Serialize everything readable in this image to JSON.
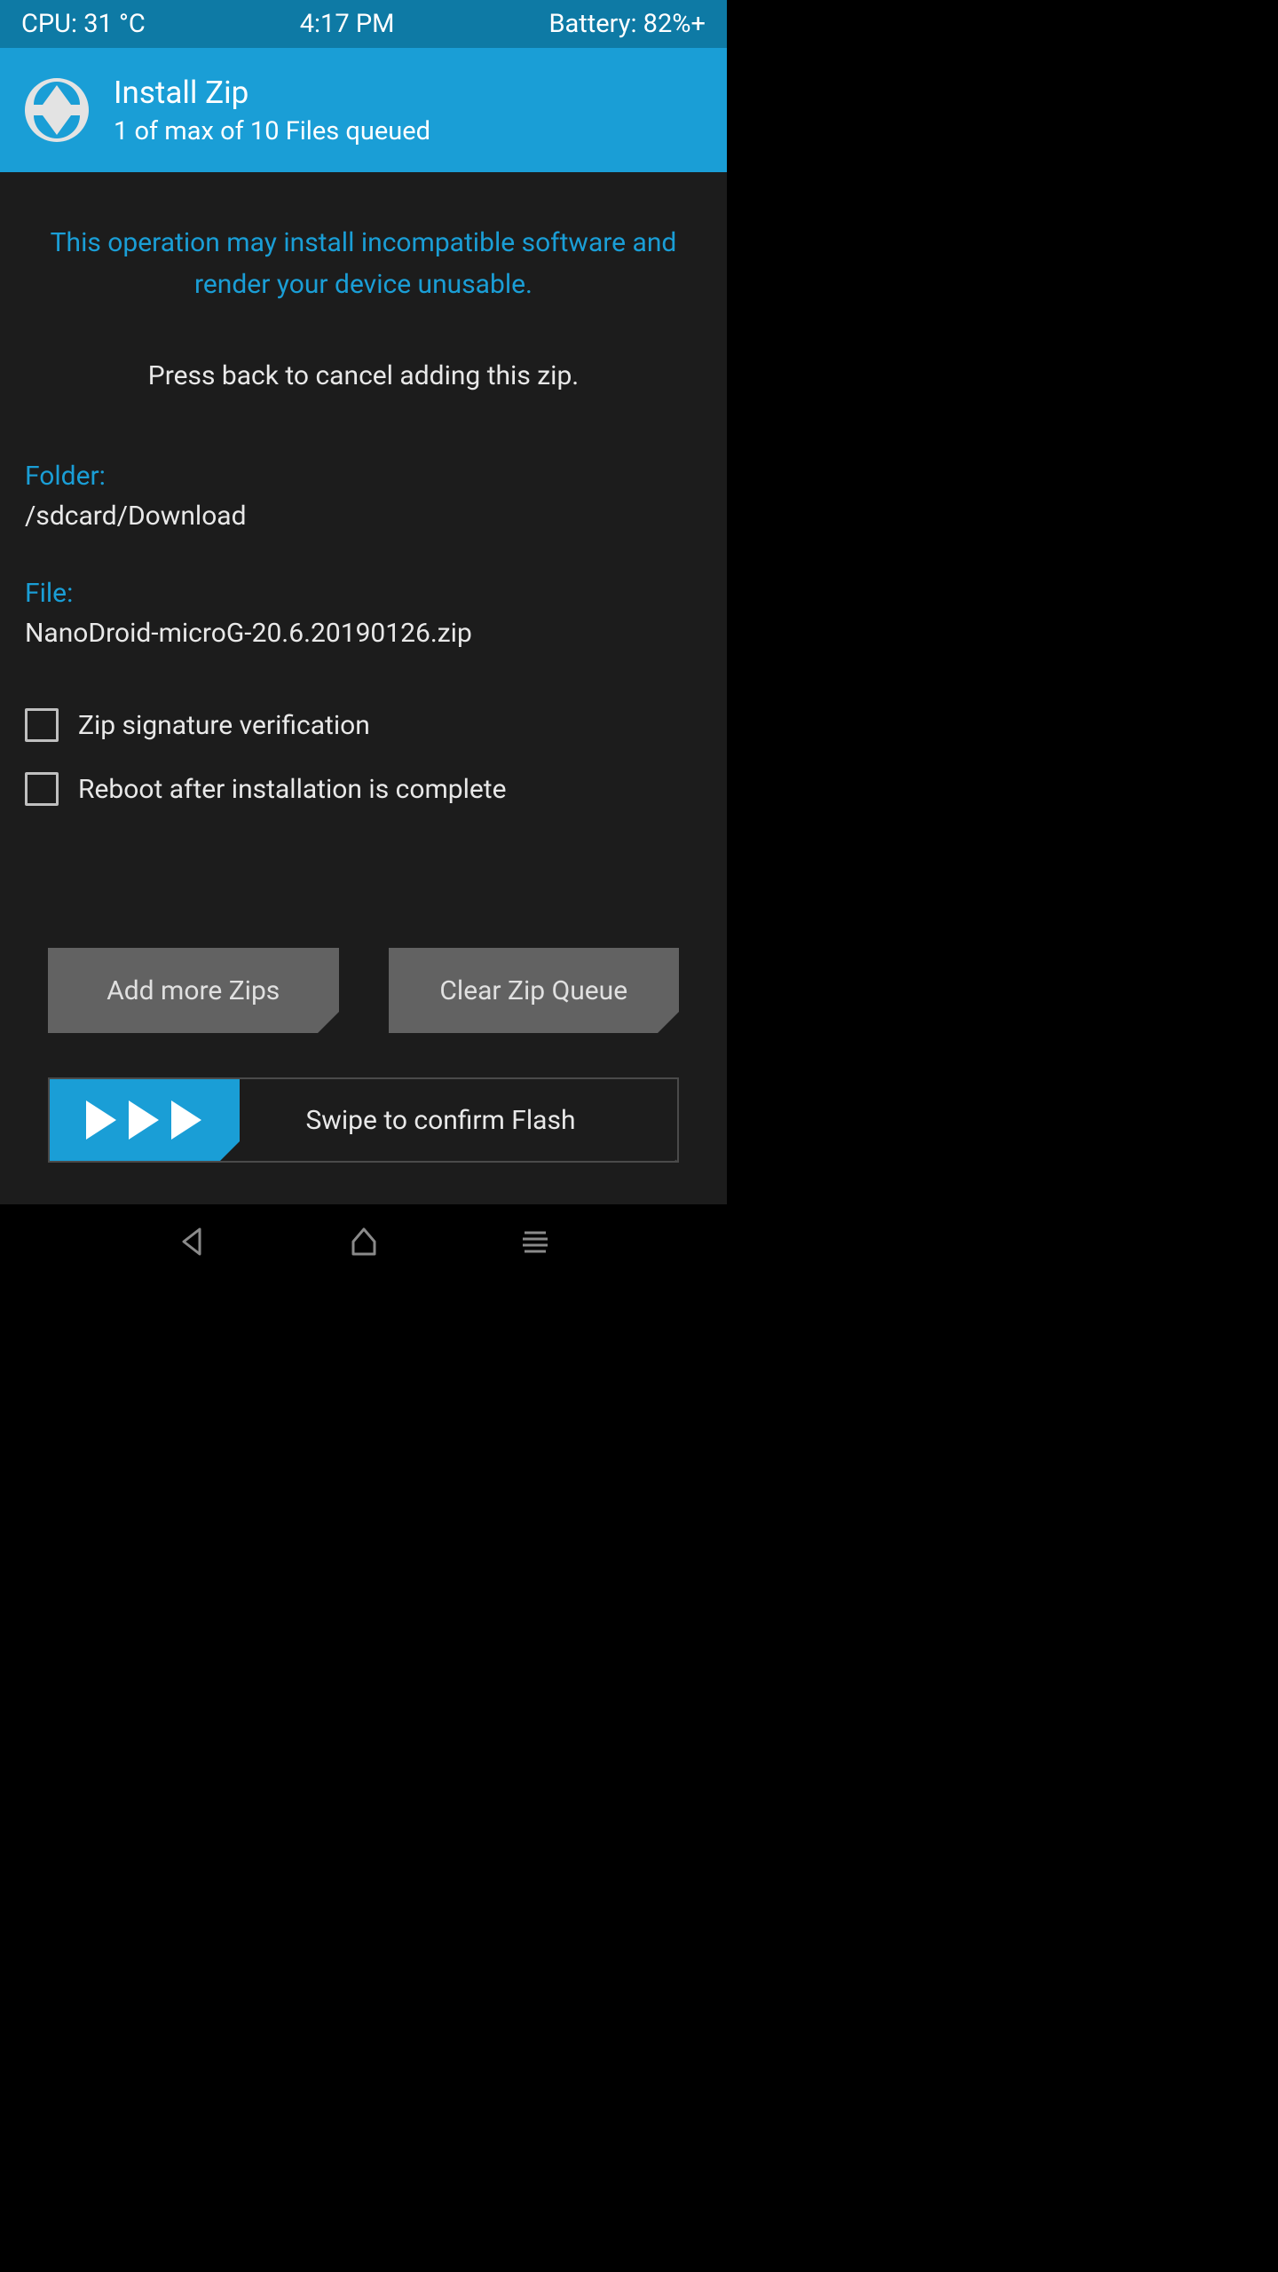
{
  "statusbar": {
    "cpu": "CPU: 31 °C",
    "time": "4:17 PM",
    "battery": "Battery: 82%+"
  },
  "header": {
    "title": "Install Zip",
    "subtitle": "1 of max of 10 Files queued"
  },
  "warning": "This operation may install incompatible software and render your device unusable.",
  "instruction": "Press back to cancel adding this zip.",
  "folder": {
    "label": "Folder:",
    "value": "/sdcard/Download"
  },
  "file": {
    "label": "File:",
    "value": "NanoDroid-microG-20.6.20190126.zip"
  },
  "checkboxes": [
    {
      "label": "Zip signature verification"
    },
    {
      "label": "Reboot after installation is complete"
    }
  ],
  "buttons": {
    "add_more": "Add more Zips",
    "clear_queue": "Clear Zip Queue"
  },
  "slider": {
    "label": "Swipe to confirm Flash"
  }
}
